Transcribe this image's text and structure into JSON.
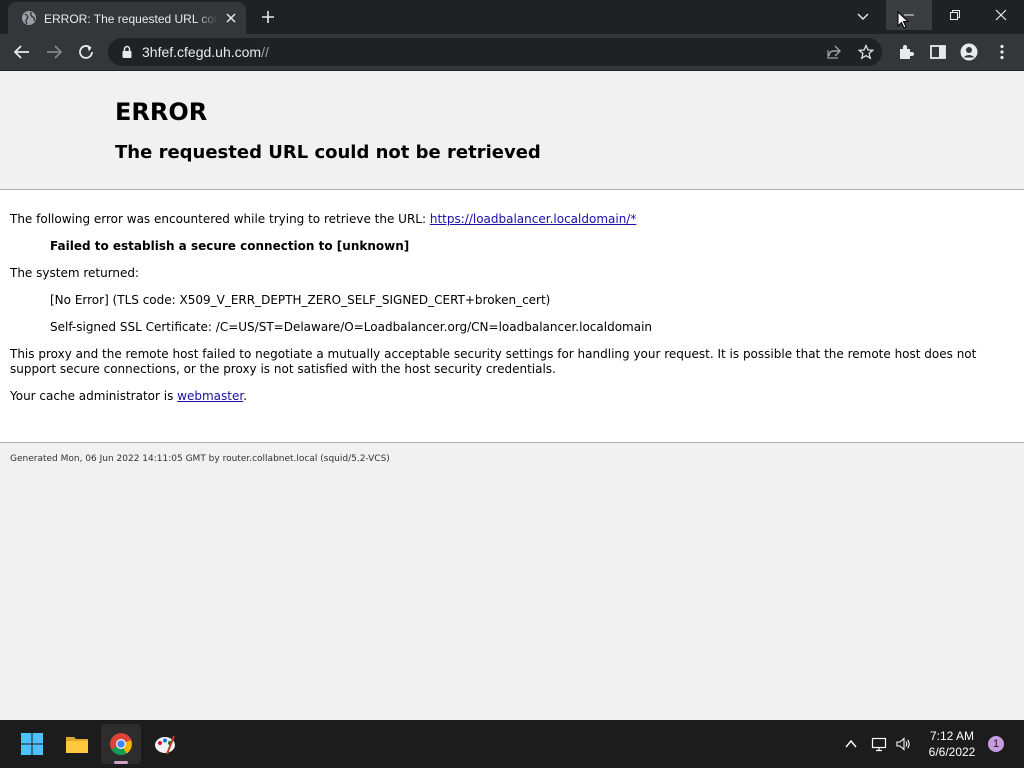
{
  "browser": {
    "tab": {
      "title": "ERROR: The requested URL could not be retrieved",
      "favicon": "globe-icon"
    },
    "address_bar": {
      "host": "3hfef.cfegd.uh.com",
      "path": "//"
    }
  },
  "page": {
    "heading": "ERROR",
    "subheading": "The requested URL could not be retrieved",
    "intro_text": "The following error was encountered while trying to retrieve the URL: ",
    "intro_link": "https://loadbalancer.localdomain/*",
    "error_message": "Failed to establish a secure connection to [unknown]",
    "system_returned": "The system returned:",
    "tls_error": "[No Error] (TLS code: X509_V_ERR_DEPTH_ZERO_SELF_SIGNED_CERT+broken_cert)",
    "ssl_cert": "Self-signed SSL Certificate: /C=US/ST=Delaware/O=Loadbalancer.org/CN=loadbalancer.localdomain",
    "explanation": "This proxy and the remote host failed to negotiate a mutually acceptable security settings for handling your request. It is possible that the remote host does not support secure connections, or the proxy is not satisfied with the host security credentials.",
    "admin_prefix": "Your cache administrator is ",
    "admin_link": "webmaster",
    "admin_suffix": ".",
    "footer": "Generated Mon, 06 Jun 2022 14:11:05 GMT by router.collabnet.local (squid/5.2-VCS)"
  },
  "taskbar": {
    "apps": [
      "start-icon",
      "file-explorer-icon",
      "chrome-icon",
      "paint-icon"
    ],
    "time": "7:12 AM",
    "date": "6/6/2022",
    "notification_count": "1"
  },
  "colors": {
    "link": "#1a0dab",
    "page_background": "#f1f1f1",
    "content_background": "#ffffff",
    "browser_frame": "#202124",
    "toolbar": "#35363a"
  }
}
